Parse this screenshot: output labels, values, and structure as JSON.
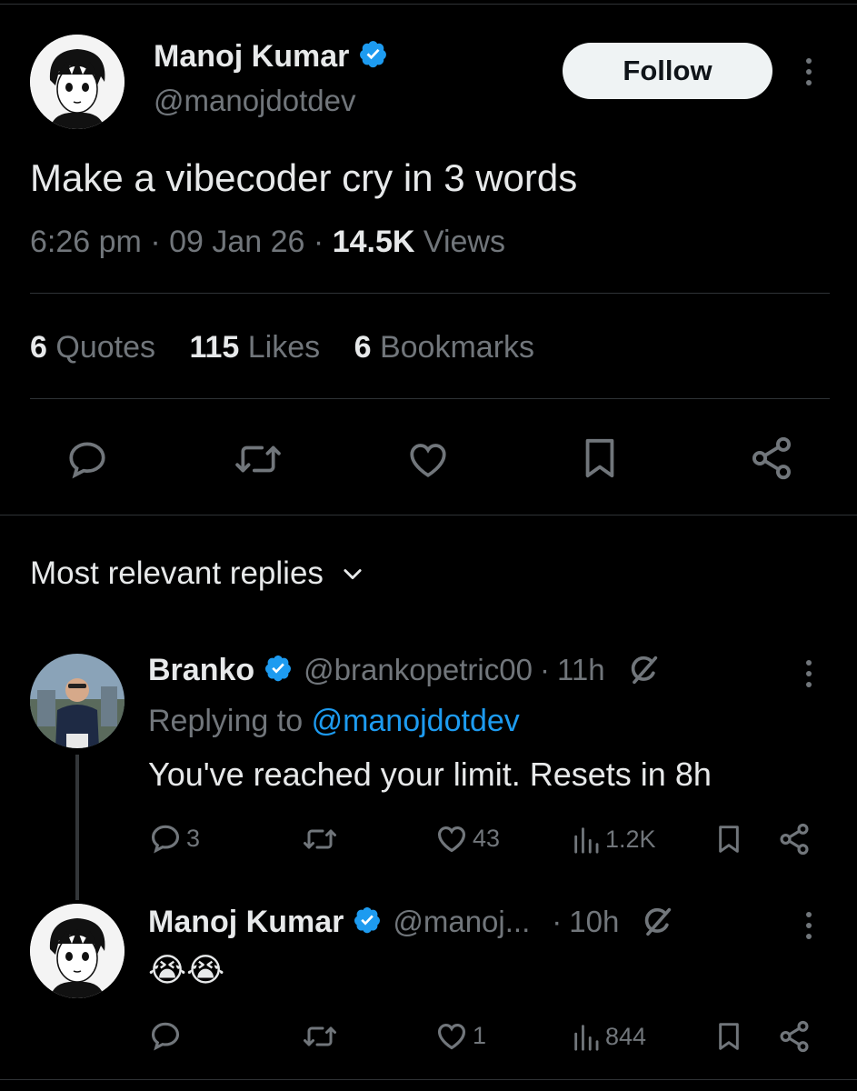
{
  "tweet": {
    "author_name": "Manoj Kumar",
    "author_handle": "@manojdotdev",
    "follow_label": "Follow",
    "text": "Make a vibecoder cry in 3 words",
    "time": "6:26 pm",
    "date": "09 Jan 26",
    "views_count": "14.5K",
    "views_label": "Views",
    "stats": {
      "quotes_count": "6",
      "quotes_label": "Quotes",
      "likes_count": "115",
      "likes_label": "Likes",
      "bookmarks_count": "6",
      "bookmarks_label": "Bookmarks"
    }
  },
  "replies_header": "Most relevant replies",
  "replies": [
    {
      "author_name": "Branko",
      "author_handle": "@brankopetric00",
      "age": "11h",
      "replying_prefix": "Replying to",
      "replying_handle": "@manojdotdev",
      "text": "You've reached your limit. Resets in 8h",
      "reply_count": "3",
      "repost_count": "",
      "like_count": "43",
      "view_count": "1.2K"
    },
    {
      "author_name": "Manoj Kumar",
      "author_handle": "@manoj...",
      "age": "10h",
      "text": "😭😭",
      "reply_count": "",
      "repost_count": "",
      "like_count": "1",
      "view_count": "844"
    }
  ],
  "colors": {
    "background": "#000000",
    "text": "#e7e9ea",
    "muted": "#71767b",
    "link": "#1d9bf0",
    "verified": "#1d9bf0",
    "divider": "#2f3336"
  },
  "icons": [
    "verified-badge-icon",
    "more-dots-icon",
    "reply-icon",
    "repost-icon",
    "like-icon",
    "bookmark-icon",
    "share-icon",
    "chevron-down-icon",
    "views-icon",
    "grok-icon"
  ]
}
